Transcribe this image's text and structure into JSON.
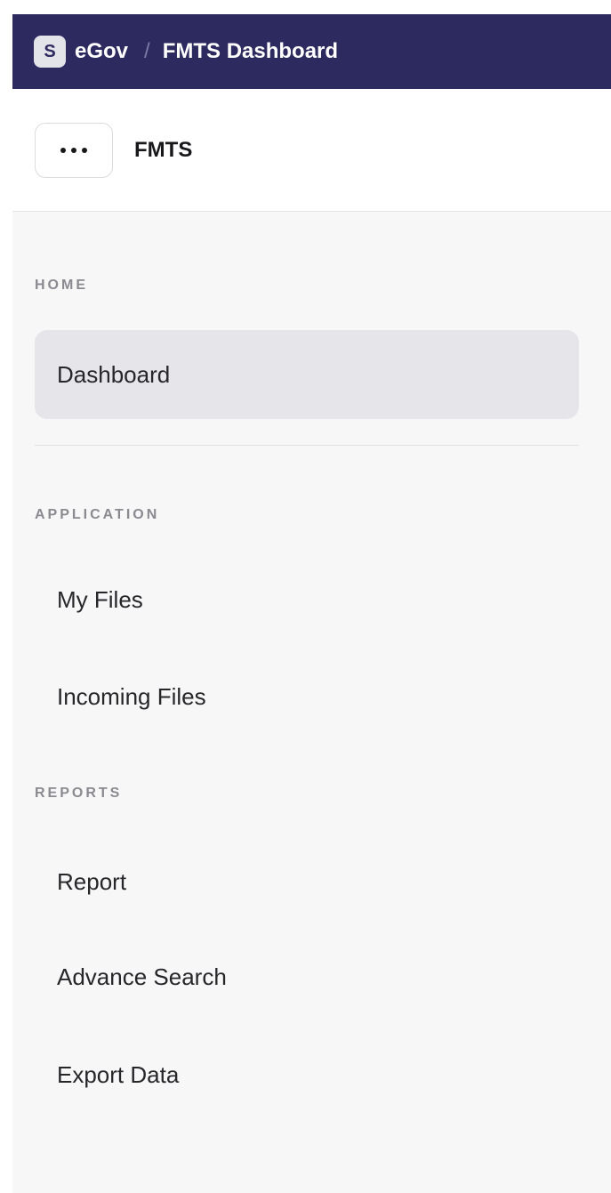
{
  "topbar": {
    "logo_letter": "S",
    "app_name": "eGov",
    "separator": "/",
    "current": "FMTS Dashboard",
    "colors": {
      "bar": "#2c2a5e",
      "badge": "#e3e4ea"
    }
  },
  "subheader": {
    "menu_icon": "more-horizontal-icon",
    "title": "FMTS"
  },
  "sidebar": {
    "sections": [
      {
        "label": "HOME",
        "items": [
          {
            "label": "Dashboard",
            "active": true
          }
        ]
      },
      {
        "label": "APPLICATION",
        "items": [
          {
            "label": "My Files"
          },
          {
            "label": "Incoming Files"
          }
        ]
      },
      {
        "label": "REPORTS",
        "items": [
          {
            "label": "Report"
          },
          {
            "label": "Advance Search"
          },
          {
            "label": "Export Data"
          }
        ]
      }
    ],
    "active_color": "#e5e5ea"
  }
}
